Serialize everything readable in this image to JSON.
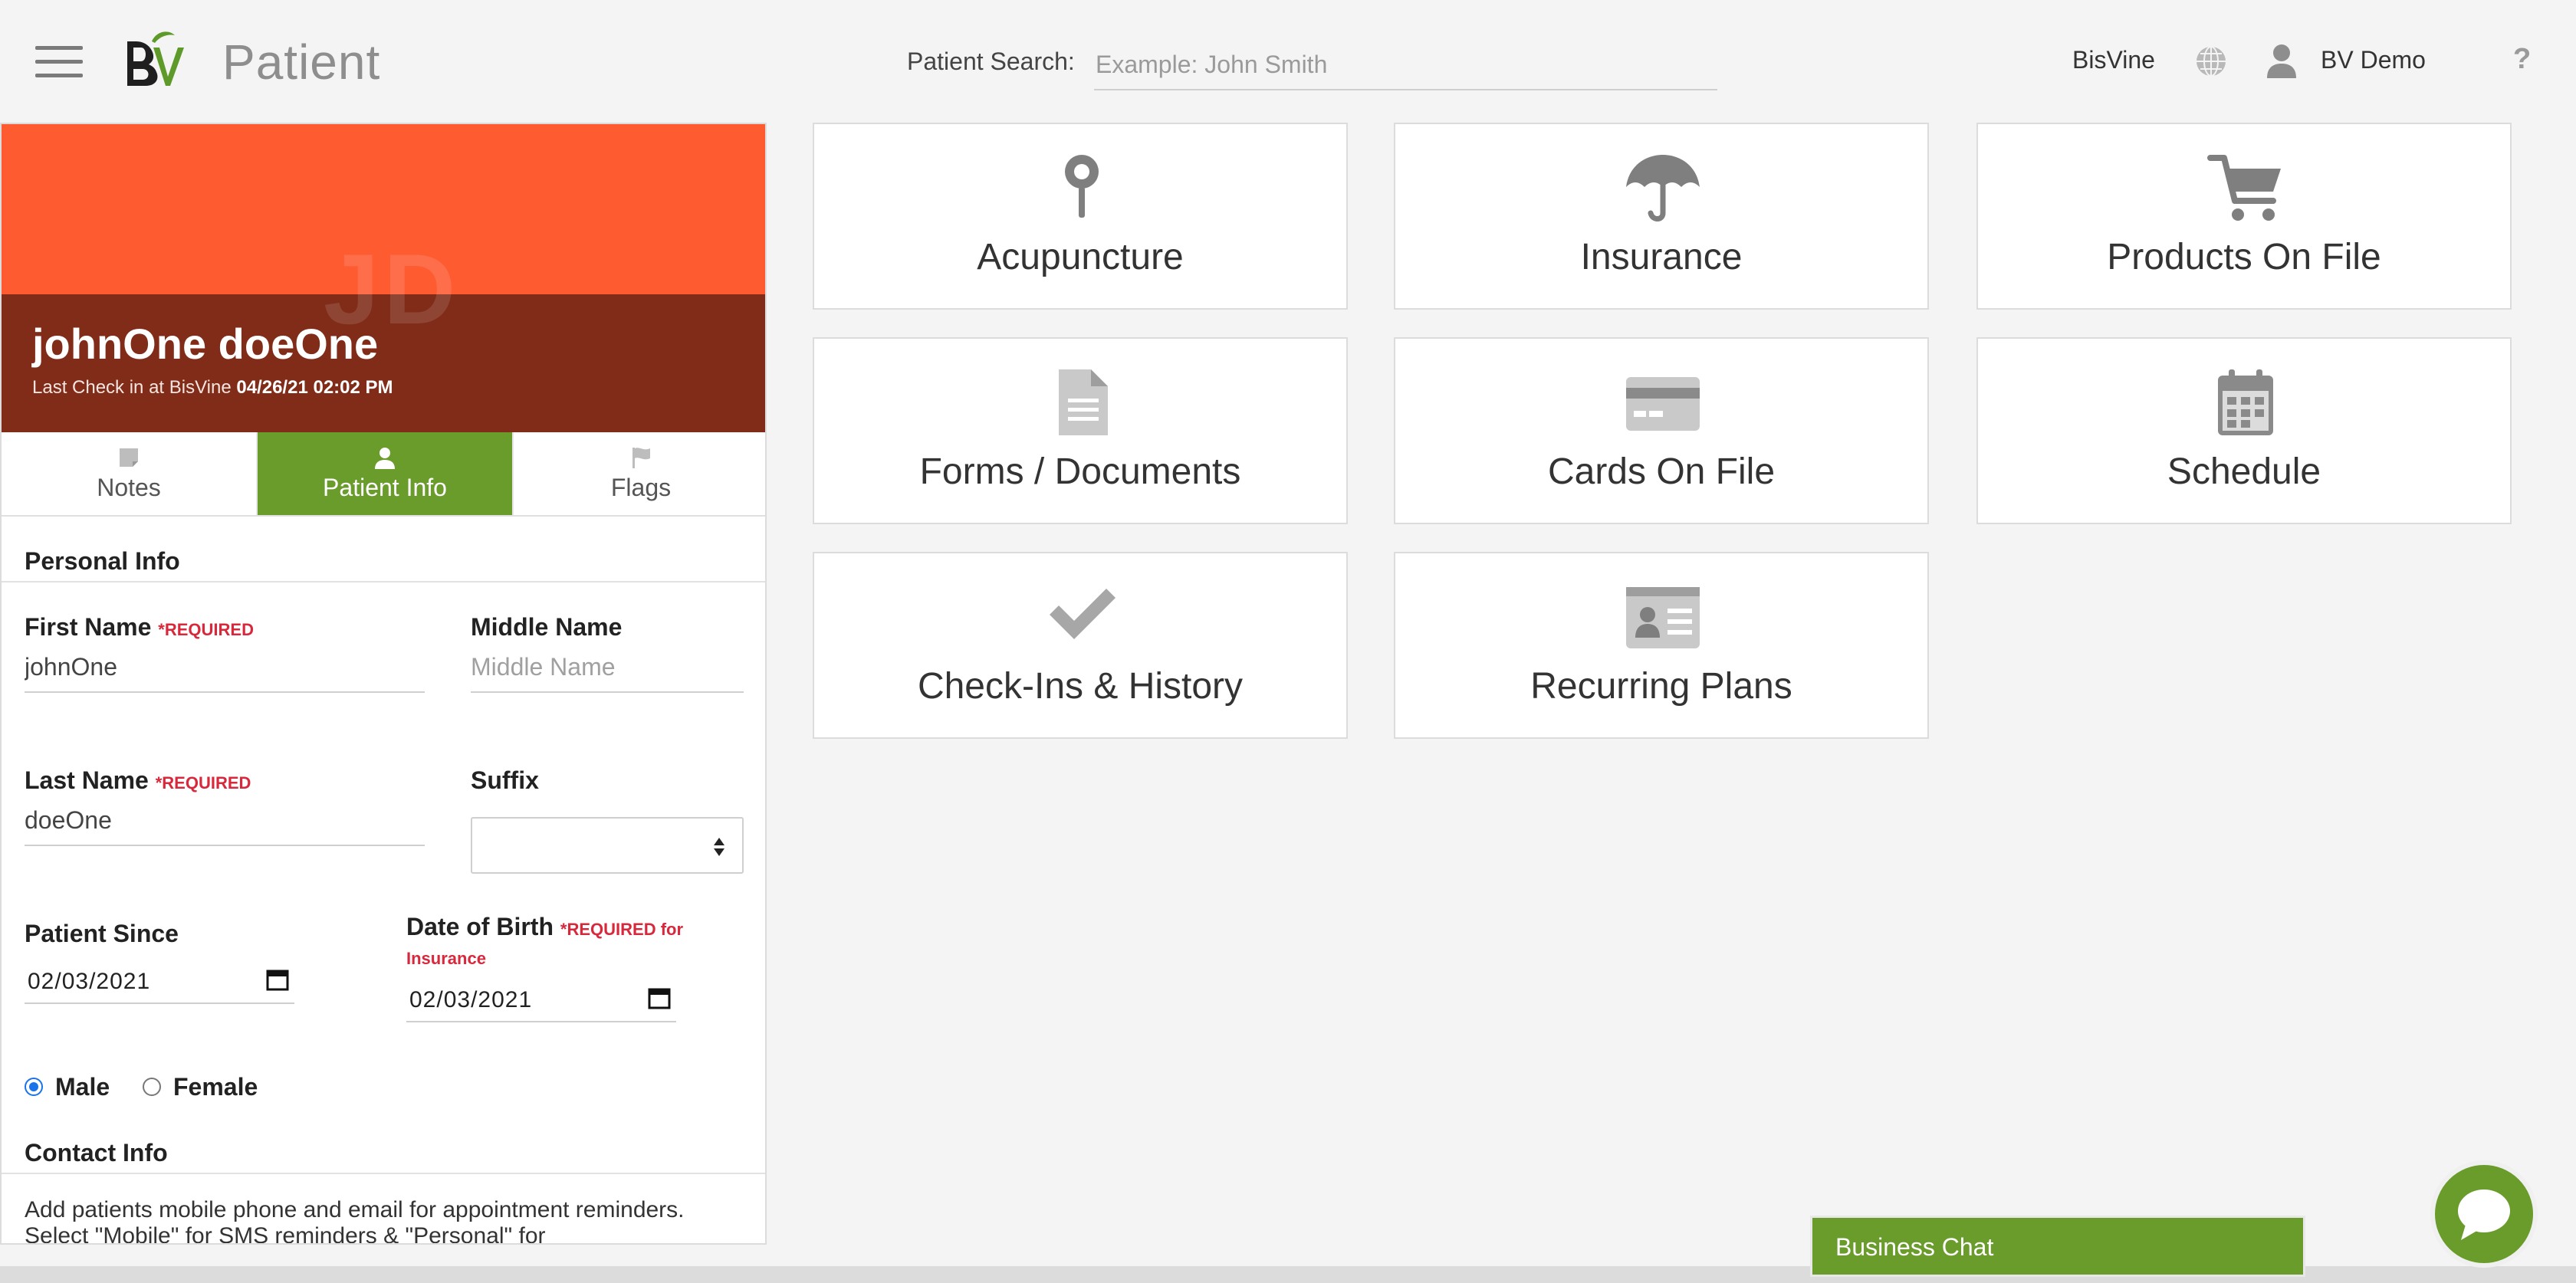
{
  "header": {
    "app_title": "Patient",
    "search_label": "Patient Search:",
    "search_placeholder": "Example: John Smith",
    "org_name": "BisVine",
    "user_name": "BV Demo",
    "help": "?"
  },
  "patient": {
    "initials": "JD",
    "name": "johnOne doeOne",
    "last_checkin_prefix": "Last Check in at BisVine",
    "last_checkin_time": "04/26/21 02:02 PM"
  },
  "tabs": [
    {
      "label": "Notes",
      "icon": "note-icon",
      "active": false
    },
    {
      "label": "Patient Info",
      "icon": "user-icon",
      "active": true
    },
    {
      "label": "Flags",
      "icon": "flag-icon",
      "active": false
    }
  ],
  "form": {
    "personal_info": "Personal Info",
    "first_name_label": "First Name",
    "first_name_req": "*REQUIRED",
    "first_name_value": "johnOne",
    "middle_name_label": "Middle Name",
    "middle_name_placeholder": "Middle Name",
    "last_name_label": "Last Name",
    "last_name_req": "*REQUIRED",
    "last_name_value": "doeOne",
    "suffix_label": "Suffix",
    "suffix_value": "",
    "patient_since_label": "Patient Since",
    "patient_since_value": "02/03/2021",
    "dob_label": "Date of Birth",
    "dob_req": "*REQUIRED for Insurance",
    "dob_value": "02/03/2021",
    "gender_male": "Male",
    "gender_female": "Female",
    "gender_selected": "Male",
    "contact_info": "Contact Info",
    "contact_help": "Add patients mobile phone and email for appointment reminders. Select \"Mobile\" for SMS reminders & \"Personal\" for"
  },
  "tiles": [
    {
      "label": "Acupuncture",
      "icon": "acupuncture-pin-icon"
    },
    {
      "label": "Insurance",
      "icon": "umbrella-icon"
    },
    {
      "label": "Products On File",
      "icon": "cart-icon"
    },
    {
      "label": "Forms / Documents",
      "icon": "document-icon"
    },
    {
      "label": "Cards On File",
      "icon": "credit-card-icon"
    },
    {
      "label": "Schedule",
      "icon": "calendar-icon"
    },
    {
      "label": "Check-Ins & History",
      "icon": "checkmark-icon"
    },
    {
      "label": "Recurring Plans",
      "icon": "id-card-icon"
    }
  ],
  "chat": {
    "label": "Business Chat"
  },
  "colors": {
    "banner_top": "#ff5b31",
    "banner_bottom": "#802c18",
    "accent_green": "#6a9c2c",
    "required_red": "#d8283c"
  }
}
